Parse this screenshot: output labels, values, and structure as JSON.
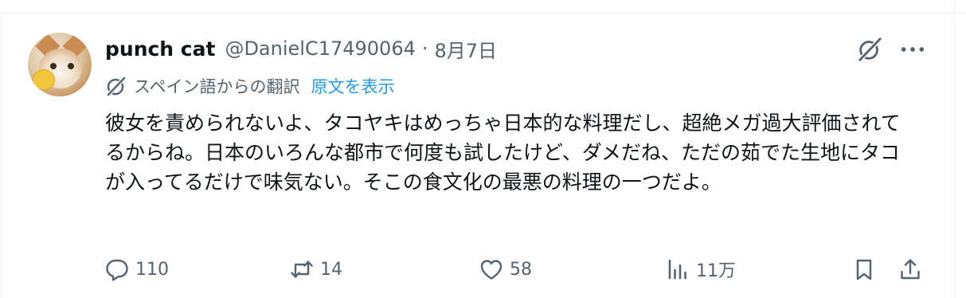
{
  "author": {
    "display_name": "punch cat",
    "handle": "@DanielC17490064",
    "separator": "·",
    "date": "8月7日"
  },
  "translation": {
    "translated_from": "スペイン語からの翻訳",
    "show_original": "原文を表示"
  },
  "tweet": {
    "text": "彼女を責められないよ、タコヤキはめっちゃ日本的な料理だし、超絶メガ過大評価されてるからね。日本のいろんな都市で何度も試したけど、ダメだね、ただの茹でた生地にタコが入ってるだけで味気ない。そこの食文化の最悪の料理の一つだよ。"
  },
  "actions": {
    "replies": "110",
    "reposts": "14",
    "likes": "58",
    "views": "11万"
  },
  "icons": {
    "grok": "grok-icon",
    "more": "more-icon",
    "translate": "translate-icon",
    "reply": "reply-icon",
    "repost": "repost-icon",
    "like": "heart-icon",
    "views": "views-icon",
    "bookmark": "bookmark-icon",
    "share": "share-icon"
  },
  "colors": {
    "text": "#0f1419",
    "secondary": "#536471",
    "link": "#1d9bf0"
  }
}
